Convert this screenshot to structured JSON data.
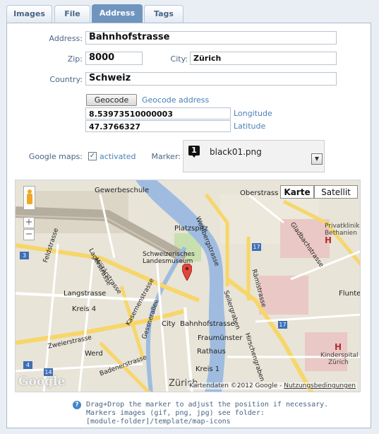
{
  "tabs": [
    {
      "label": "Images"
    },
    {
      "label": "File"
    },
    {
      "label": "Address"
    },
    {
      "label": "Tags"
    }
  ],
  "form": {
    "address_label": "Address:",
    "address_value": "Bahnhofstrasse",
    "zip_label": "Zip:",
    "zip_value": "8000",
    "city_label": "City:",
    "city_value": "Zürich",
    "country_label": "Country:",
    "country_value": "Schweiz",
    "geocode_button": "Geocode",
    "geocode_link": "Geocode address",
    "longitude_value": "8.53973510000003",
    "longitude_label": "Longitude",
    "latitude_value": "47.3766327",
    "latitude_label": "Latitude",
    "google_maps_label": "Google maps:",
    "activated_label": "activated",
    "marker_label": "Marker:",
    "marker_badge": "1",
    "marker_file": "black01.png"
  },
  "map": {
    "type_map": "Karte",
    "type_satellite": "Satellit",
    "zoom_in": "+",
    "zoom_out": "−",
    "logo": "Google",
    "copyright": "Kartendaten ©2012 Google - ",
    "terms": "Nutzungsbedingungen",
    "labels": {
      "gewerbeschule": "Gewerbeschule",
      "oberstrass": "Oberstrass",
      "weinbergstrasse": "Weinbergstrasse",
      "platzspitz": "Platzspitz",
      "gladbachstrasse": "Gladbachstrasse",
      "privatklinik": "Privatklinik",
      "bethanien": "Bethanien",
      "museum1": "Schweizerisches",
      "museum2": "Landesmuseum",
      "feldstrasse": "Feldstrasse",
      "lagerstrasse": "Lagerstrasse",
      "militaerstrasse": "Militärstrasse",
      "langstrasse": "Langstrasse",
      "kreis4": "Kreis 4",
      "kasernenstrasse": "Kasernenstrasse",
      "gessnerallee": "Gessnerallee",
      "raemistrasse": "Rämistrasse",
      "seilergraben": "Seilergraben",
      "hirschengraben": "Hirschengraben",
      "city": "City",
      "bahnhofstrasse": "Bahnhofstrasse",
      "fraumuenster": "Fraumünster",
      "rathaus": "Rathaus",
      "kreis1": "Kreis 1",
      "zweierstrasse": "Zweierstrasse",
      "werd": "Werd",
      "badenerstrasse": "Badenerstrasse",
      "zuerich": "Zürich",
      "kinderspital1": "Kinderspital",
      "kinderspital2": "Zürich",
      "flunte": "Flunte",
      "r3": "3",
      "r17a": "17",
      "r17b": "17",
      "r4": "4",
      "r14": "14",
      "h": "H"
    }
  },
  "help": {
    "icon": "?",
    "line1": "Drag+Drop the marker to adjust the position if necessary.",
    "line2": "Markers images (gif, png, jpg) see folder:",
    "line3": "[module-folder]/template/map-icons"
  }
}
